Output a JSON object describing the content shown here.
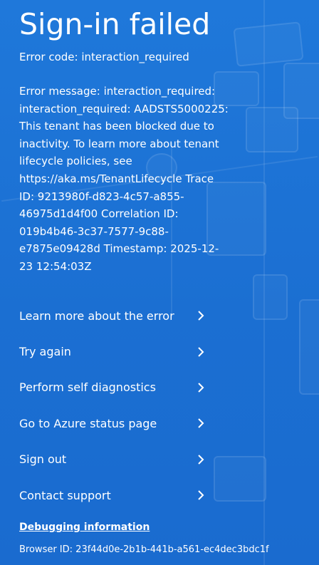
{
  "page": {
    "title": "Sign-in failed",
    "error_code": "Error code: interaction_required",
    "error_message_lines": [
      "Error message: interaction_required:",
      "interaction_required: AADSTS5000225:",
      "This tenant has been blocked due to",
      "inactivity. To learn more about tenant",
      "lifecycle policies, see",
      "https://aka.ms/TenantLifecycle Trace",
      "ID: 9213980f-d823-4c57-a855-",
      "46975d1d4f00 Correlation ID:",
      "019b4b46-3c37-7577-9c88-",
      "e7875e09428d Timestamp: 2025-12-",
      "23 12:54:03Z"
    ]
  },
  "actions": [
    {
      "label": "Learn more about the error",
      "icon": "chevron-right-icon"
    },
    {
      "label": "Try again",
      "icon": "chevron-right-icon"
    },
    {
      "label": "Perform self diagnostics",
      "icon": "chevron-right-icon"
    },
    {
      "label": "Go to Azure status page",
      "icon": "chevron-right-icon"
    },
    {
      "label": "Sign out",
      "icon": "chevron-right-icon"
    },
    {
      "label": "Contact support",
      "icon": "chevron-right-icon"
    }
  ],
  "debug": {
    "link_label": "Debugging information",
    "browser_id": "Browser ID: 23f44d0e-2b1b-441b-a561-ec4dec3bdc1f"
  },
  "colors": {
    "background": "#1c72d6",
    "text": "#ffffff"
  }
}
